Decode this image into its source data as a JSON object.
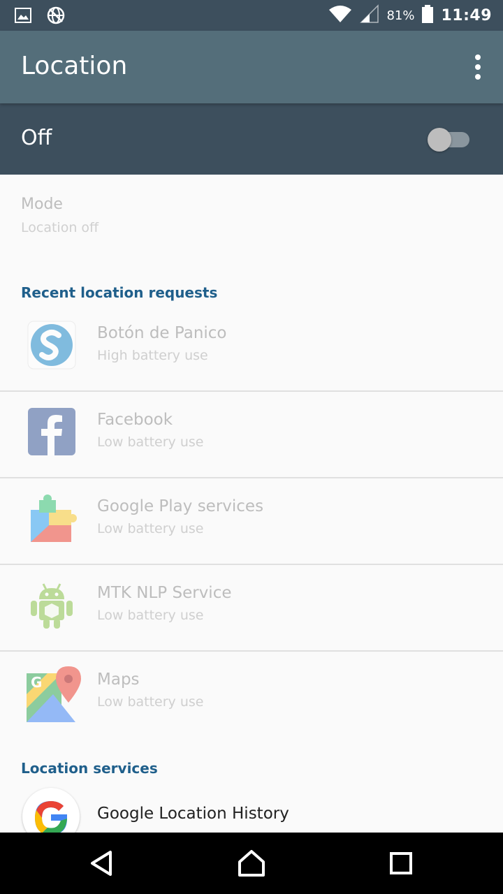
{
  "status_bar": {
    "battery_percent": "81%",
    "time": "11:49",
    "icons": [
      "image-icon",
      "vpn-globe-icon",
      "wifi-icon",
      "signal-icon",
      "battery-icon"
    ]
  },
  "app_bar": {
    "title": "Location",
    "overflow_icon": "more-vert-icon"
  },
  "master_switch": {
    "label": "Off",
    "state": false
  },
  "mode": {
    "title": "Mode",
    "value": "Location off"
  },
  "recent_requests": {
    "header": "Recent location requests",
    "items": [
      {
        "name": "Botón de Panico",
        "battery": "High battery use",
        "icon": "boton-de-panico-app-icon"
      },
      {
        "name": "Facebook",
        "battery": "Low battery use",
        "icon": "facebook-app-icon"
      },
      {
        "name": "Google Play services",
        "battery": "Low battery use",
        "icon": "google-play-services-icon"
      },
      {
        "name": "MTK NLP Service",
        "battery": "Low battery use",
        "icon": "android-app-icon"
      },
      {
        "name": "Maps",
        "battery": "Low battery use",
        "icon": "google-maps-icon"
      }
    ]
  },
  "location_services": {
    "header": "Location services",
    "items": [
      {
        "name": "Google Location History",
        "icon": "google-g-icon"
      }
    ]
  },
  "colors": {
    "status_bar": "#3d4f5d",
    "app_bar": "#546e7a",
    "section_header": "#1f5f8b",
    "background": "#fafafa"
  }
}
